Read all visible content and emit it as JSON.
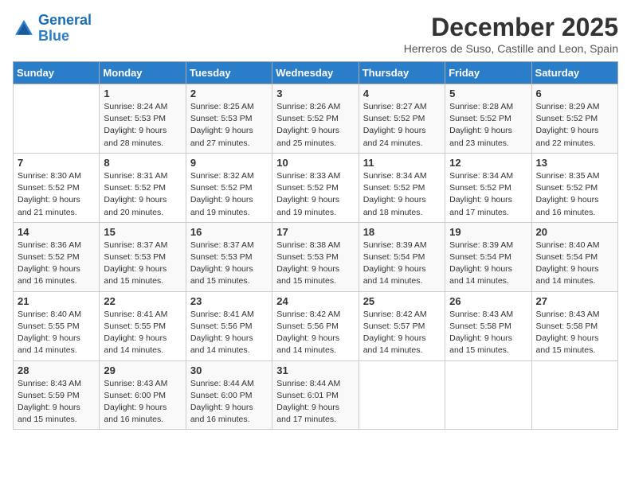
{
  "logo": {
    "line1": "General",
    "line2": "Blue"
  },
  "title": "December 2025",
  "location": "Herreros de Suso, Castille and Leon, Spain",
  "header": {
    "days": [
      "Sunday",
      "Monday",
      "Tuesday",
      "Wednesday",
      "Thursday",
      "Friday",
      "Saturday"
    ]
  },
  "weeks": [
    [
      {
        "day": "",
        "sunrise": "",
        "sunset": "",
        "daylight": ""
      },
      {
        "day": "1",
        "sunrise": "Sunrise: 8:24 AM",
        "sunset": "Sunset: 5:53 PM",
        "daylight": "Daylight: 9 hours and 28 minutes."
      },
      {
        "day": "2",
        "sunrise": "Sunrise: 8:25 AM",
        "sunset": "Sunset: 5:53 PM",
        "daylight": "Daylight: 9 hours and 27 minutes."
      },
      {
        "day": "3",
        "sunrise": "Sunrise: 8:26 AM",
        "sunset": "Sunset: 5:52 PM",
        "daylight": "Daylight: 9 hours and 25 minutes."
      },
      {
        "day": "4",
        "sunrise": "Sunrise: 8:27 AM",
        "sunset": "Sunset: 5:52 PM",
        "daylight": "Daylight: 9 hours and 24 minutes."
      },
      {
        "day": "5",
        "sunrise": "Sunrise: 8:28 AM",
        "sunset": "Sunset: 5:52 PM",
        "daylight": "Daylight: 9 hours and 23 minutes."
      },
      {
        "day": "6",
        "sunrise": "Sunrise: 8:29 AM",
        "sunset": "Sunset: 5:52 PM",
        "daylight": "Daylight: 9 hours and 22 minutes."
      }
    ],
    [
      {
        "day": "7",
        "sunrise": "Sunrise: 8:30 AM",
        "sunset": "Sunset: 5:52 PM",
        "daylight": "Daylight: 9 hours and 21 minutes."
      },
      {
        "day": "8",
        "sunrise": "Sunrise: 8:31 AM",
        "sunset": "Sunset: 5:52 PM",
        "daylight": "Daylight: 9 hours and 20 minutes."
      },
      {
        "day": "9",
        "sunrise": "Sunrise: 8:32 AM",
        "sunset": "Sunset: 5:52 PM",
        "daylight": "Daylight: 9 hours and 19 minutes."
      },
      {
        "day": "10",
        "sunrise": "Sunrise: 8:33 AM",
        "sunset": "Sunset: 5:52 PM",
        "daylight": "Daylight: 9 hours and 19 minutes."
      },
      {
        "day": "11",
        "sunrise": "Sunrise: 8:34 AM",
        "sunset": "Sunset: 5:52 PM",
        "daylight": "Daylight: 9 hours and 18 minutes."
      },
      {
        "day": "12",
        "sunrise": "Sunrise: 8:34 AM",
        "sunset": "Sunset: 5:52 PM",
        "daylight": "Daylight: 9 hours and 17 minutes."
      },
      {
        "day": "13",
        "sunrise": "Sunrise: 8:35 AM",
        "sunset": "Sunset: 5:52 PM",
        "daylight": "Daylight: 9 hours and 16 minutes."
      }
    ],
    [
      {
        "day": "14",
        "sunrise": "Sunrise: 8:36 AM",
        "sunset": "Sunset: 5:52 PM",
        "daylight": "Daylight: 9 hours and 16 minutes."
      },
      {
        "day": "15",
        "sunrise": "Sunrise: 8:37 AM",
        "sunset": "Sunset: 5:53 PM",
        "daylight": "Daylight: 9 hours and 15 minutes."
      },
      {
        "day": "16",
        "sunrise": "Sunrise: 8:37 AM",
        "sunset": "Sunset: 5:53 PM",
        "daylight": "Daylight: 9 hours and 15 minutes."
      },
      {
        "day": "17",
        "sunrise": "Sunrise: 8:38 AM",
        "sunset": "Sunset: 5:53 PM",
        "daylight": "Daylight: 9 hours and 15 minutes."
      },
      {
        "day": "18",
        "sunrise": "Sunrise: 8:39 AM",
        "sunset": "Sunset: 5:54 PM",
        "daylight": "Daylight: 9 hours and 14 minutes."
      },
      {
        "day": "19",
        "sunrise": "Sunrise: 8:39 AM",
        "sunset": "Sunset: 5:54 PM",
        "daylight": "Daylight: 9 hours and 14 minutes."
      },
      {
        "day": "20",
        "sunrise": "Sunrise: 8:40 AM",
        "sunset": "Sunset: 5:54 PM",
        "daylight": "Daylight: 9 hours and 14 minutes."
      }
    ],
    [
      {
        "day": "21",
        "sunrise": "Sunrise: 8:40 AM",
        "sunset": "Sunset: 5:55 PM",
        "daylight": "Daylight: 9 hours and 14 minutes."
      },
      {
        "day": "22",
        "sunrise": "Sunrise: 8:41 AM",
        "sunset": "Sunset: 5:55 PM",
        "daylight": "Daylight: 9 hours and 14 minutes."
      },
      {
        "day": "23",
        "sunrise": "Sunrise: 8:41 AM",
        "sunset": "Sunset: 5:56 PM",
        "daylight": "Daylight: 9 hours and 14 minutes."
      },
      {
        "day": "24",
        "sunrise": "Sunrise: 8:42 AM",
        "sunset": "Sunset: 5:56 PM",
        "daylight": "Daylight: 9 hours and 14 minutes."
      },
      {
        "day": "25",
        "sunrise": "Sunrise: 8:42 AM",
        "sunset": "Sunset: 5:57 PM",
        "daylight": "Daylight: 9 hours and 14 minutes."
      },
      {
        "day": "26",
        "sunrise": "Sunrise: 8:43 AM",
        "sunset": "Sunset: 5:58 PM",
        "daylight": "Daylight: 9 hours and 15 minutes."
      },
      {
        "day": "27",
        "sunrise": "Sunrise: 8:43 AM",
        "sunset": "Sunset: 5:58 PM",
        "daylight": "Daylight: 9 hours and 15 minutes."
      }
    ],
    [
      {
        "day": "28",
        "sunrise": "Sunrise: 8:43 AM",
        "sunset": "Sunset: 5:59 PM",
        "daylight": "Daylight: 9 hours and 15 minutes."
      },
      {
        "day": "29",
        "sunrise": "Sunrise: 8:43 AM",
        "sunset": "Sunset: 6:00 PM",
        "daylight": "Daylight: 9 hours and 16 minutes."
      },
      {
        "day": "30",
        "sunrise": "Sunrise: 8:44 AM",
        "sunset": "Sunset: 6:00 PM",
        "daylight": "Daylight: 9 hours and 16 minutes."
      },
      {
        "day": "31",
        "sunrise": "Sunrise: 8:44 AM",
        "sunset": "Sunset: 6:01 PM",
        "daylight": "Daylight: 9 hours and 17 minutes."
      },
      {
        "day": "",
        "sunrise": "",
        "sunset": "",
        "daylight": ""
      },
      {
        "day": "",
        "sunrise": "",
        "sunset": "",
        "daylight": ""
      },
      {
        "day": "",
        "sunrise": "",
        "sunset": "",
        "daylight": ""
      }
    ]
  ]
}
